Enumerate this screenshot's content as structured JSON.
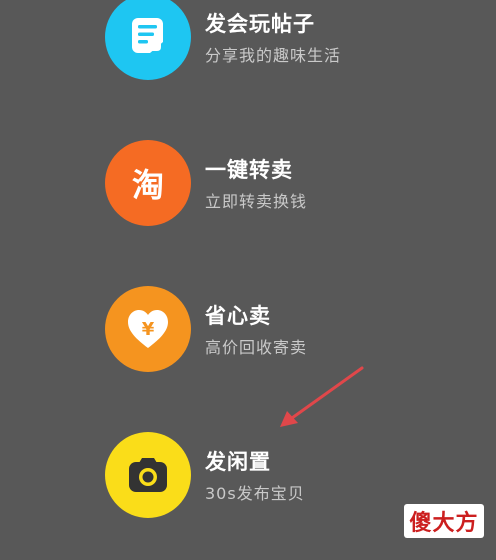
{
  "menu": {
    "items": [
      {
        "title": "发会玩帖子",
        "subtitle": "分享我的趣味生活",
        "icon": "note-post-icon",
        "color": "#1ec6f2"
      },
      {
        "title": "一键转卖",
        "subtitle": "立即转卖换钱",
        "icon": "taobao-icon",
        "color": "#f56b23",
        "icon_text": "淘"
      },
      {
        "title": "省心卖",
        "subtitle": "高价回收寄卖",
        "icon": "heart-yuan-icon",
        "color": "#f5941f",
        "icon_text": "¥"
      },
      {
        "title": "发闲置",
        "subtitle": "30s发布宝贝",
        "icon": "camera-icon",
        "color": "#fadd19"
      }
    ]
  },
  "annotation": {
    "arrow_color": "#e0474a"
  },
  "watermark": {
    "text": "傻大方"
  }
}
